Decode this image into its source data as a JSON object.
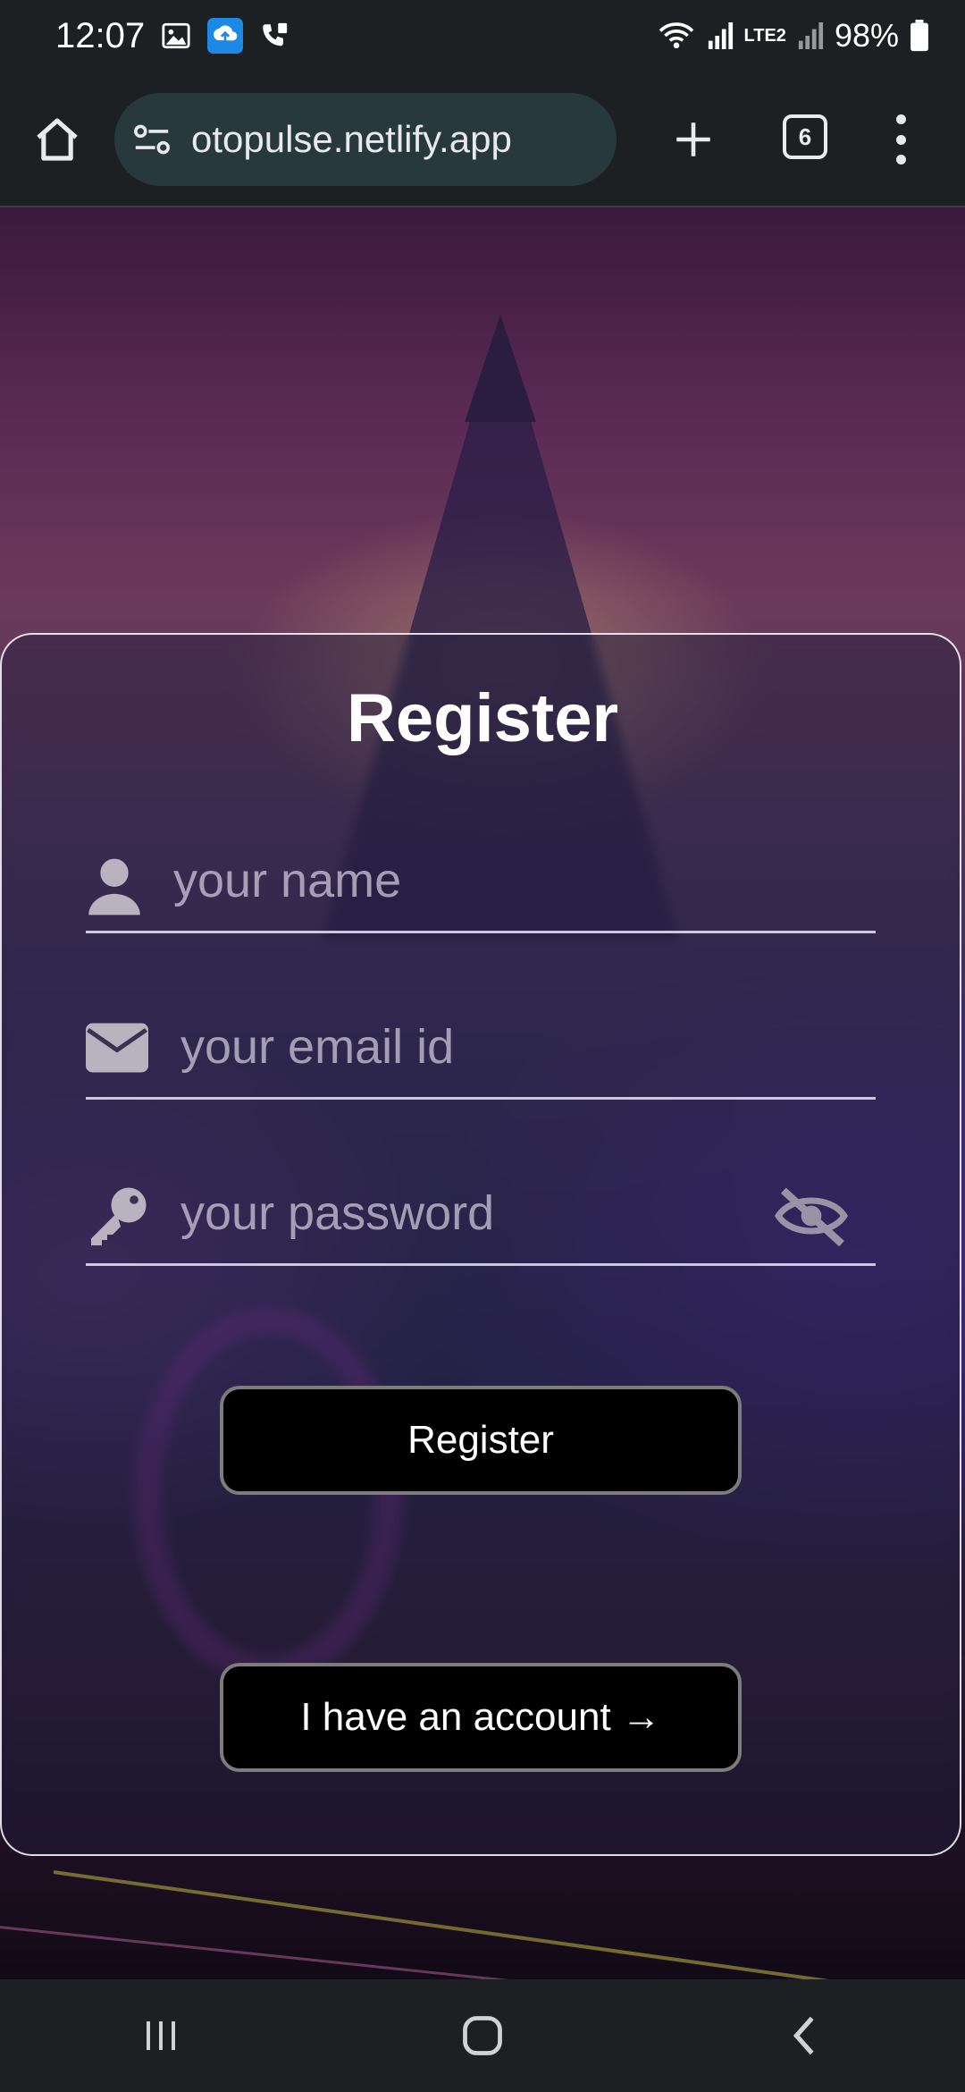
{
  "status_bar": {
    "time": "12:07",
    "battery": "98%",
    "network_label": "LTE2",
    "icons": [
      "gallery-icon",
      "cloud-upload-icon",
      "wifi-calling-icon",
      "wifi-icon",
      "signal-icon",
      "battery-icon"
    ]
  },
  "browser": {
    "url": "otopulse.netlify.app",
    "tab_count": "6"
  },
  "form": {
    "title": "Register",
    "name_placeholder": "your name",
    "email_placeholder": "your email id",
    "password_placeholder": "your password",
    "register_button": "Register",
    "account_button": "I have an account",
    "account_arrow": "→"
  },
  "colors": {
    "button_bg": "#000000",
    "card_border": "#ffffff",
    "browser_bar": "#1c2023",
    "url_pill": "#27393c"
  }
}
